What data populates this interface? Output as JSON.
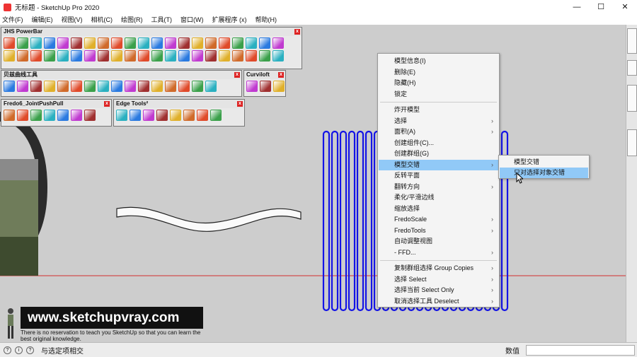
{
  "window": {
    "title": "无标题 - SketchUp Pro 2020",
    "min": "—",
    "max": "☐",
    "close": "✕"
  },
  "menu": [
    "文件(F)",
    "编辑(E)",
    "视图(V)",
    "相机(C)",
    "绘图(R)",
    "工具(T)",
    "窗口(W)",
    "扩展程序 (x)",
    "帮助(H)"
  ],
  "toolbars": {
    "powerbar": {
      "title": "JHS PowerBar"
    },
    "bezier": {
      "title": "贝兹曲线工具"
    },
    "curviloft": {
      "title": "Curviloft"
    },
    "fredo": {
      "title": "Fredo6_JointPushPull"
    },
    "edge": {
      "title": "Edge Tools²"
    },
    "close": "x"
  },
  "context_menu": [
    {
      "label": "模型信息(I)",
      "submenu": false
    },
    {
      "label": "删除(E)",
      "submenu": false
    },
    {
      "label": "隐藏(H)",
      "submenu": false
    },
    {
      "label": "锁定",
      "submenu": false
    },
    {
      "label": "炸开模型",
      "submenu": false
    },
    {
      "label": "选择",
      "submenu": true
    },
    {
      "label": "面积(A)",
      "submenu": true
    },
    {
      "label": "创建组件(C)...",
      "submenu": false
    },
    {
      "label": "创建群组(G)",
      "submenu": false
    },
    {
      "label": "模型交错",
      "submenu": true,
      "highlighted": true
    },
    {
      "label": "反转平面",
      "submenu": false
    },
    {
      "label": "翻转方向",
      "submenu": true
    },
    {
      "label": "柔化/平滑边线",
      "submenu": false
    },
    {
      "label": "缩放选择",
      "submenu": false
    },
    {
      "label": "FredoScale",
      "submenu": true
    },
    {
      "label": "FredoTools",
      "submenu": true
    },
    {
      "label": "自动调整视图",
      "submenu": false
    },
    {
      "label": "- FFD...",
      "submenu": true
    },
    {
      "label": "复制群组选择 Group Copies",
      "submenu": true
    },
    {
      "label": "选择 Select",
      "submenu": true
    },
    {
      "label": "选择当前 Select Only",
      "submenu": true
    },
    {
      "label": "取消选择工具 Deselect",
      "submenu": true
    }
  ],
  "submenu": [
    {
      "label": "模型交错",
      "highlighted": false
    },
    {
      "label": "只对选择对象交错",
      "highlighted": true
    }
  ],
  "right_tabs": [
    "",
    "",
    "",
    ""
  ],
  "watermark": {
    "url": "www.sketchupvray.com",
    "tagline": "There is no reservation to teach you SketchUp so that you can learn the best original knowledge."
  },
  "status": {
    "text": "与选定项相交",
    "measure_label": "数值",
    "measure_value": ""
  },
  "colors": {
    "selection": "#1414e6",
    "axis_red": "#d23030",
    "menu_highlight": "#91c9f7"
  }
}
